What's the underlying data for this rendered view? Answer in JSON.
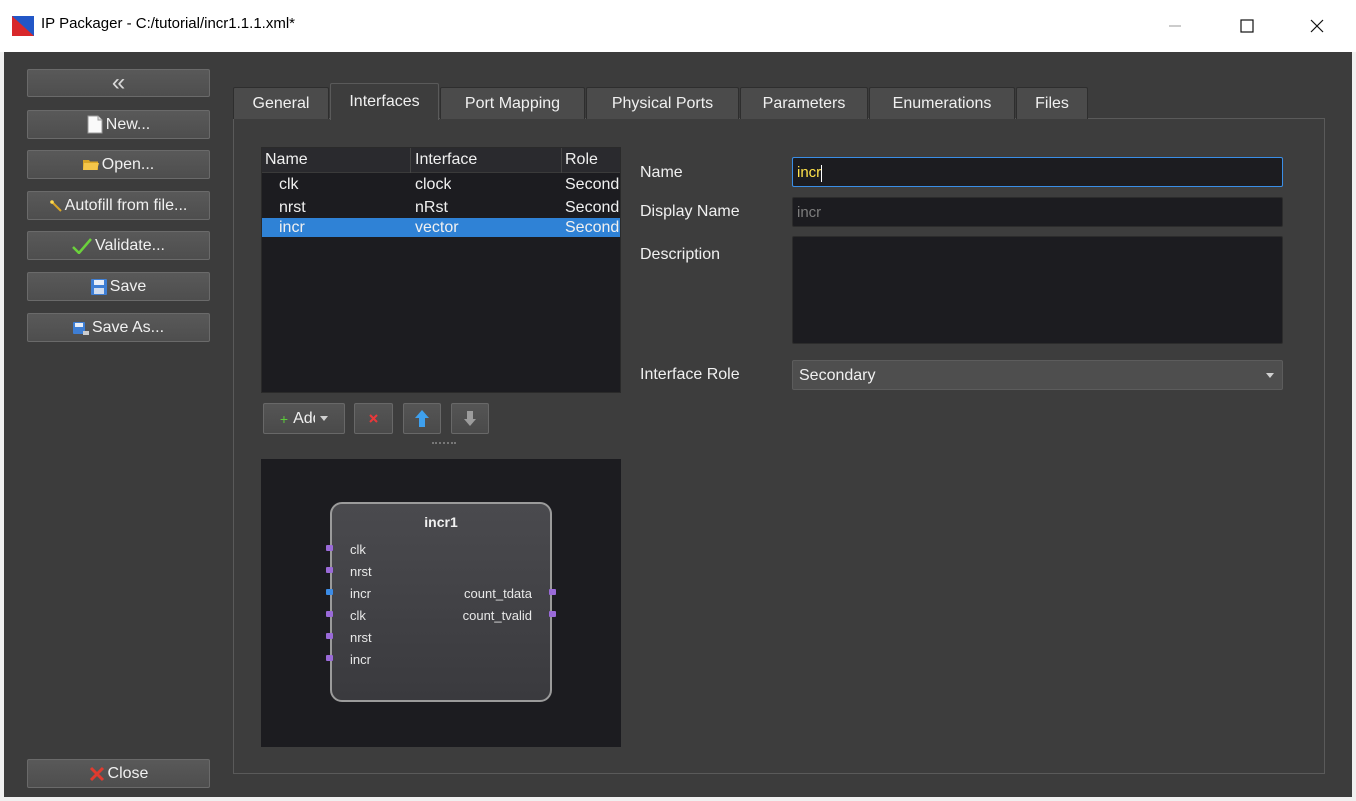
{
  "window": {
    "title": "IP Packager - C:/tutorial/incr1.1.1.xml*",
    "icons": [
      "app-icon",
      "minimize-icon",
      "maximize-icon",
      "close-icon"
    ]
  },
  "sidebar": {
    "collapse_glyph": "«",
    "new_label": "New...",
    "open_label": "Open...",
    "autofill_label": "Autofill from file...",
    "validate_label": "Validate...",
    "save_label": "Save",
    "save_as_label": "Save As...",
    "close_label": "Close"
  },
  "tabs": [
    {
      "label": "General"
    },
    {
      "label": "Interfaces"
    },
    {
      "label": "Port Mapping"
    },
    {
      "label": "Physical Ports"
    },
    {
      "label": "Parameters"
    },
    {
      "label": "Enumerations"
    },
    {
      "label": "Files"
    }
  ],
  "active_tab": "Interfaces",
  "interface_list": {
    "columns": [
      "Name",
      "Interface",
      "Role"
    ],
    "rows": [
      {
        "name": "clk",
        "interface": "clock",
        "role": "Secondary"
      },
      {
        "name": "nrst",
        "interface": "nRst",
        "role": "Secondary"
      },
      {
        "name": "incr",
        "interface": "vector",
        "role": "Secondary"
      }
    ],
    "selected_row": 2
  },
  "list_toolbar": {
    "add_label": "Add",
    "icons": [
      "add-icon",
      "delete-icon",
      "move-up-icon",
      "move-down-icon"
    ]
  },
  "symbol": {
    "title": "incr1",
    "left_pins": [
      "clk",
      "nrst",
      "incr",
      "clk",
      "nrst",
      "incr"
    ],
    "right_pins": [
      "count_tdata",
      "count_tvalid"
    ]
  },
  "form": {
    "name_label": "Name",
    "name_value": "incr",
    "display_name_label": "Display Name",
    "display_name_placeholder": "incr",
    "description_label": "Description",
    "description_value": "",
    "role_label": "Interface Role",
    "role_value": "Secondary"
  },
  "colors": {
    "selection": "#2f82d6",
    "focus_border": "#3a8ee6",
    "pin": "#9a6ad8",
    "pin_active": "#3b8be6"
  }
}
